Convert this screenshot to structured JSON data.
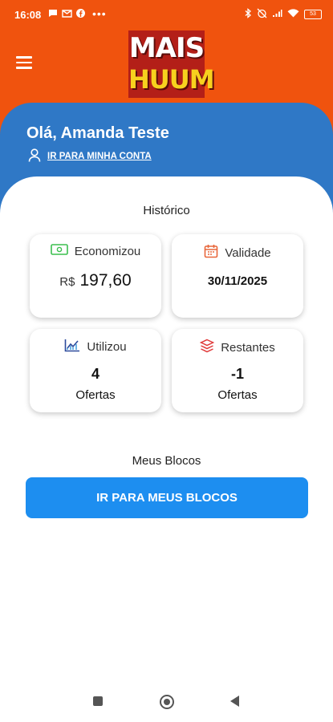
{
  "status_bar": {
    "time": "16:08",
    "battery": "53"
  },
  "header": {
    "logo_line1": "MAIS",
    "logo_line2": "HUUM",
    "brand_color": "#f0530e"
  },
  "user": {
    "greeting": "Olá, Amanda Teste",
    "account_link": "IR PARA MINHA CONTA"
  },
  "history": {
    "title": "Histórico",
    "saved": {
      "label": "Economizou",
      "currency": "R$",
      "value": "197,60"
    },
    "validity": {
      "label": "Validade",
      "value": "30/11/2025"
    },
    "used": {
      "label": "Utilizou",
      "value": "4",
      "unit": "Ofertas"
    },
    "remaining": {
      "label": "Restantes",
      "value": "-1",
      "unit": "Ofertas"
    }
  },
  "blocks": {
    "title": "Meus Blocos",
    "button_label": "IR PARA MEUS BLOCOS"
  },
  "colors": {
    "header_blue": "#2f78c6",
    "button_blue": "#1d8ef0"
  }
}
